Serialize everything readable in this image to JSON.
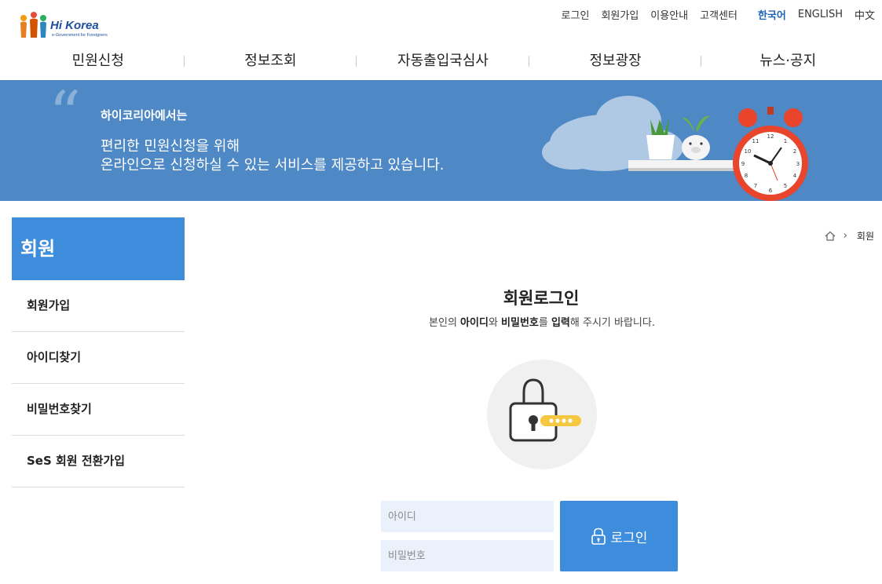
{
  "header": {
    "logo": {
      "brand": "Hi Korea",
      "tagline": "e-Government for Foreigners"
    },
    "util_links": [
      "로그인",
      "회원가입",
      "이용안내",
      "고객센터"
    ],
    "languages": [
      {
        "label": "한국어",
        "active": true
      },
      {
        "label": "ENGLISH",
        "active": false
      },
      {
        "label": "中文",
        "active": false
      }
    ],
    "gnb": [
      "민원신청",
      "정보조회",
      "자동출입국심사",
      "정보광장",
      "뉴스·공지"
    ]
  },
  "banner": {
    "small": "하이코리아에서는",
    "line1": "편리한 민원신청을 위해",
    "line2": "온라인으로 신청하실 수 있는 서비스를 제공하고 있습니다.",
    "bg_color": "#4e88c5"
  },
  "sidebar": {
    "title": "회원",
    "items": [
      "회원가입",
      "아이디찾기",
      "비밀번호찾기",
      "SeS 회원 전환가입"
    ]
  },
  "breadcrumb": {
    "icon": "home-icon",
    "current": "회원"
  },
  "login": {
    "title": "회원로그인",
    "desc_parts": [
      "본인의 ",
      "아이디",
      "와 ",
      "비밀번호",
      "를 ",
      "입력",
      "해 주시기 바랍니다."
    ],
    "id_placeholder": "아이디",
    "pw_placeholder": "비밀번호",
    "button_label": "로그인",
    "accent": "#3d8ddc"
  }
}
